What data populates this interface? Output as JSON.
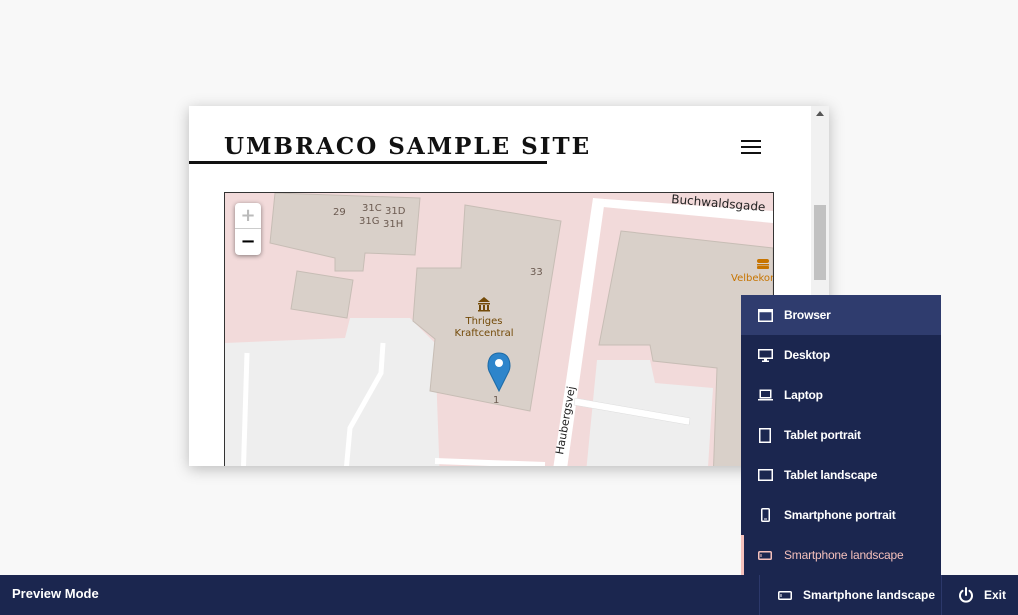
{
  "site": {
    "logo_text": "UMBRACO SAMPLE SITE"
  },
  "map": {
    "zoom_in_label": "+",
    "zoom_out_label": "−",
    "labels": {
      "street_buchwaldsgade": "Buchwaldsgade",
      "street_haubergsvej": "Haubergsvej",
      "poi_thriges_line1": "Thriges",
      "poi_thriges_line2": "Kraftcentral",
      "poi_velbekom": "Velbekon",
      "house_29": "29",
      "house_31c": "31C",
      "house_31d": "31D",
      "house_31g": "31G",
      "house_31h": "31H",
      "house_33": "33",
      "house_1": "1"
    },
    "colors": {
      "land": "#f2dada",
      "building": "#d9d0c9",
      "road": "#ffffff",
      "parking": "#eeeeee",
      "marker": "#2e85cb",
      "poi_label": "#734a08",
      "food_poi": "#c77400"
    }
  },
  "device_menu": {
    "items": [
      {
        "label": "Browser",
        "icon": "browser-icon"
      },
      {
        "label": "Desktop",
        "icon": "desktop-icon"
      },
      {
        "label": "Laptop",
        "icon": "laptop-icon"
      },
      {
        "label": "Tablet portrait",
        "icon": "tablet-portrait-icon"
      },
      {
        "label": "Tablet landscape",
        "icon": "tablet-landscape-icon"
      },
      {
        "label": "Smartphone portrait",
        "icon": "smartphone-portrait-icon"
      },
      {
        "label": "Smartphone landscape",
        "icon": "smartphone-landscape-icon"
      }
    ],
    "active_color": "#f5c1bc",
    "background": "#1b264f"
  },
  "bottom_bar": {
    "title": "Preview Mode",
    "current_device": "Smartphone landscape",
    "exit_label": "Exit"
  }
}
